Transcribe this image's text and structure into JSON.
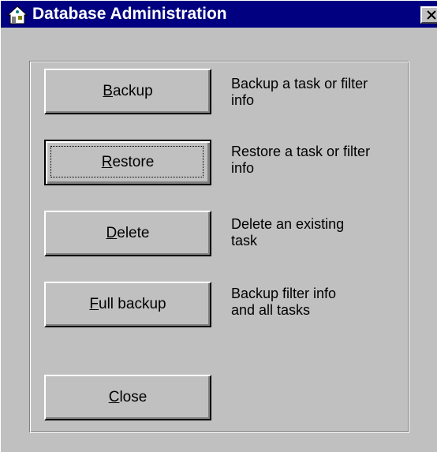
{
  "window": {
    "title": "Database Administration",
    "close_glyph": "✕",
    "title_icon": "house-icon"
  },
  "buttons": [
    {
      "mnemonic": "B",
      "rest": "ackup",
      "description_line1": "Backup a task or filter",
      "description_line2": "info"
    },
    {
      "mnemonic": "R",
      "rest": "estore",
      "description_line1": "Restore a task or filter",
      "description_line2": "info",
      "default": true
    },
    {
      "mnemonic": "D",
      "rest": "elete",
      "description_line1": "Delete an existing",
      "description_line2": "task"
    },
    {
      "mnemonic": "F",
      "rest": "ull backup",
      "description_line1": "Backup filter info",
      "description_line2": "and all tasks"
    }
  ],
  "close_button": {
    "mnemonic": "C",
    "rest": "lose"
  },
  "colors": {
    "titlebar": "#000080",
    "face": "#c0c0c0",
    "highlight": "#ffffff",
    "shadow": "#808080",
    "dark_shadow": "#000000"
  }
}
